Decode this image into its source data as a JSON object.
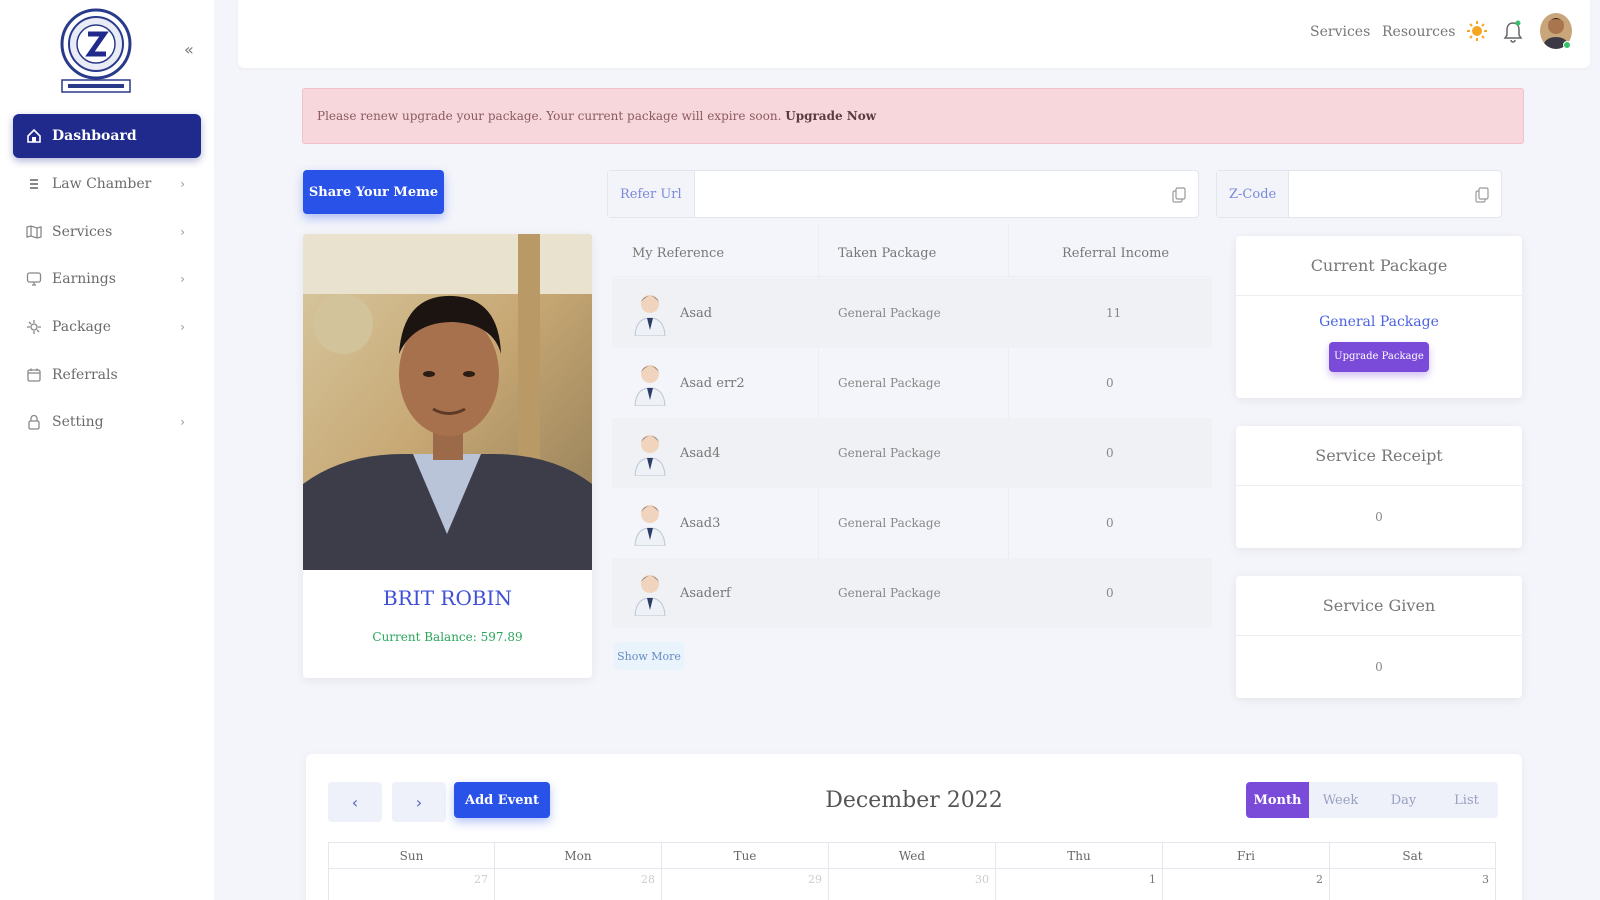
{
  "sidebar": {
    "logo_text": "Lawyer Logo",
    "items": [
      {
        "label": "Dashboard",
        "icon": "home-icon",
        "active": true
      },
      {
        "label": "Law Chamber",
        "icon": "list-icon",
        "has_children": true
      },
      {
        "label": "Services",
        "icon": "map-icon",
        "has_children": true
      },
      {
        "label": "Earnings",
        "icon": "monitor-icon",
        "has_children": true
      },
      {
        "label": "Package",
        "icon": "settings-icon",
        "has_children": true
      },
      {
        "label": "Referrals",
        "icon": "calendar-icon"
      },
      {
        "label": "Setting",
        "icon": "lock-icon",
        "has_children": true
      }
    ]
  },
  "topbar": {
    "services": "Services",
    "resources": "Resources"
  },
  "alert": {
    "text": "Please renew upgrade your package. Your current package will expire soon.",
    "link": "Upgrade Now"
  },
  "share_button": "Share Your Meme",
  "refer_url": {
    "label": "Refer Url",
    "value": ""
  },
  "z_code": {
    "label": "Z-Code",
    "value": ""
  },
  "profile": {
    "name": "BRIT ROBIN",
    "balance": "Current Balance: 597.89"
  },
  "references": {
    "headers": [
      "My Reference",
      "Taken Package",
      "Referral Income"
    ],
    "rows": [
      {
        "name": "Asad",
        "package": "General Package",
        "income": "11"
      },
      {
        "name": "Asad err2",
        "package": "General Package",
        "income": "0"
      },
      {
        "name": "Asad4",
        "package": "General Package",
        "income": "0"
      },
      {
        "name": "Asad3",
        "package": "General Package",
        "income": "0"
      },
      {
        "name": "Asaderf",
        "package": "General Package",
        "income": "0"
      }
    ],
    "show_more": "Show More"
  },
  "current_package": {
    "title": "Current Package",
    "package": "General Package",
    "button": "Upgrade Package"
  },
  "service_receipt": {
    "title": "Service Receipt",
    "value": "0"
  },
  "service_given": {
    "title": "Service Given",
    "value": "0"
  },
  "calendar": {
    "title": "December 2022",
    "add_event": "Add Event",
    "views": [
      "Month",
      "Week",
      "Day",
      "List"
    ],
    "active_view": "Month",
    "days_of_week": [
      "Sun",
      "Mon",
      "Tue",
      "Wed",
      "Thu",
      "Fri",
      "Sat"
    ],
    "first_row": [
      "27",
      "28",
      "29",
      "30",
      "1",
      "2",
      "3"
    ]
  },
  "colors": {
    "primary": "#2952e8",
    "sidebar_active": "#1f2a8c",
    "purple": "#7a4ad8",
    "alert_bg": "#f8d7dc",
    "success": "#2aa55a"
  }
}
